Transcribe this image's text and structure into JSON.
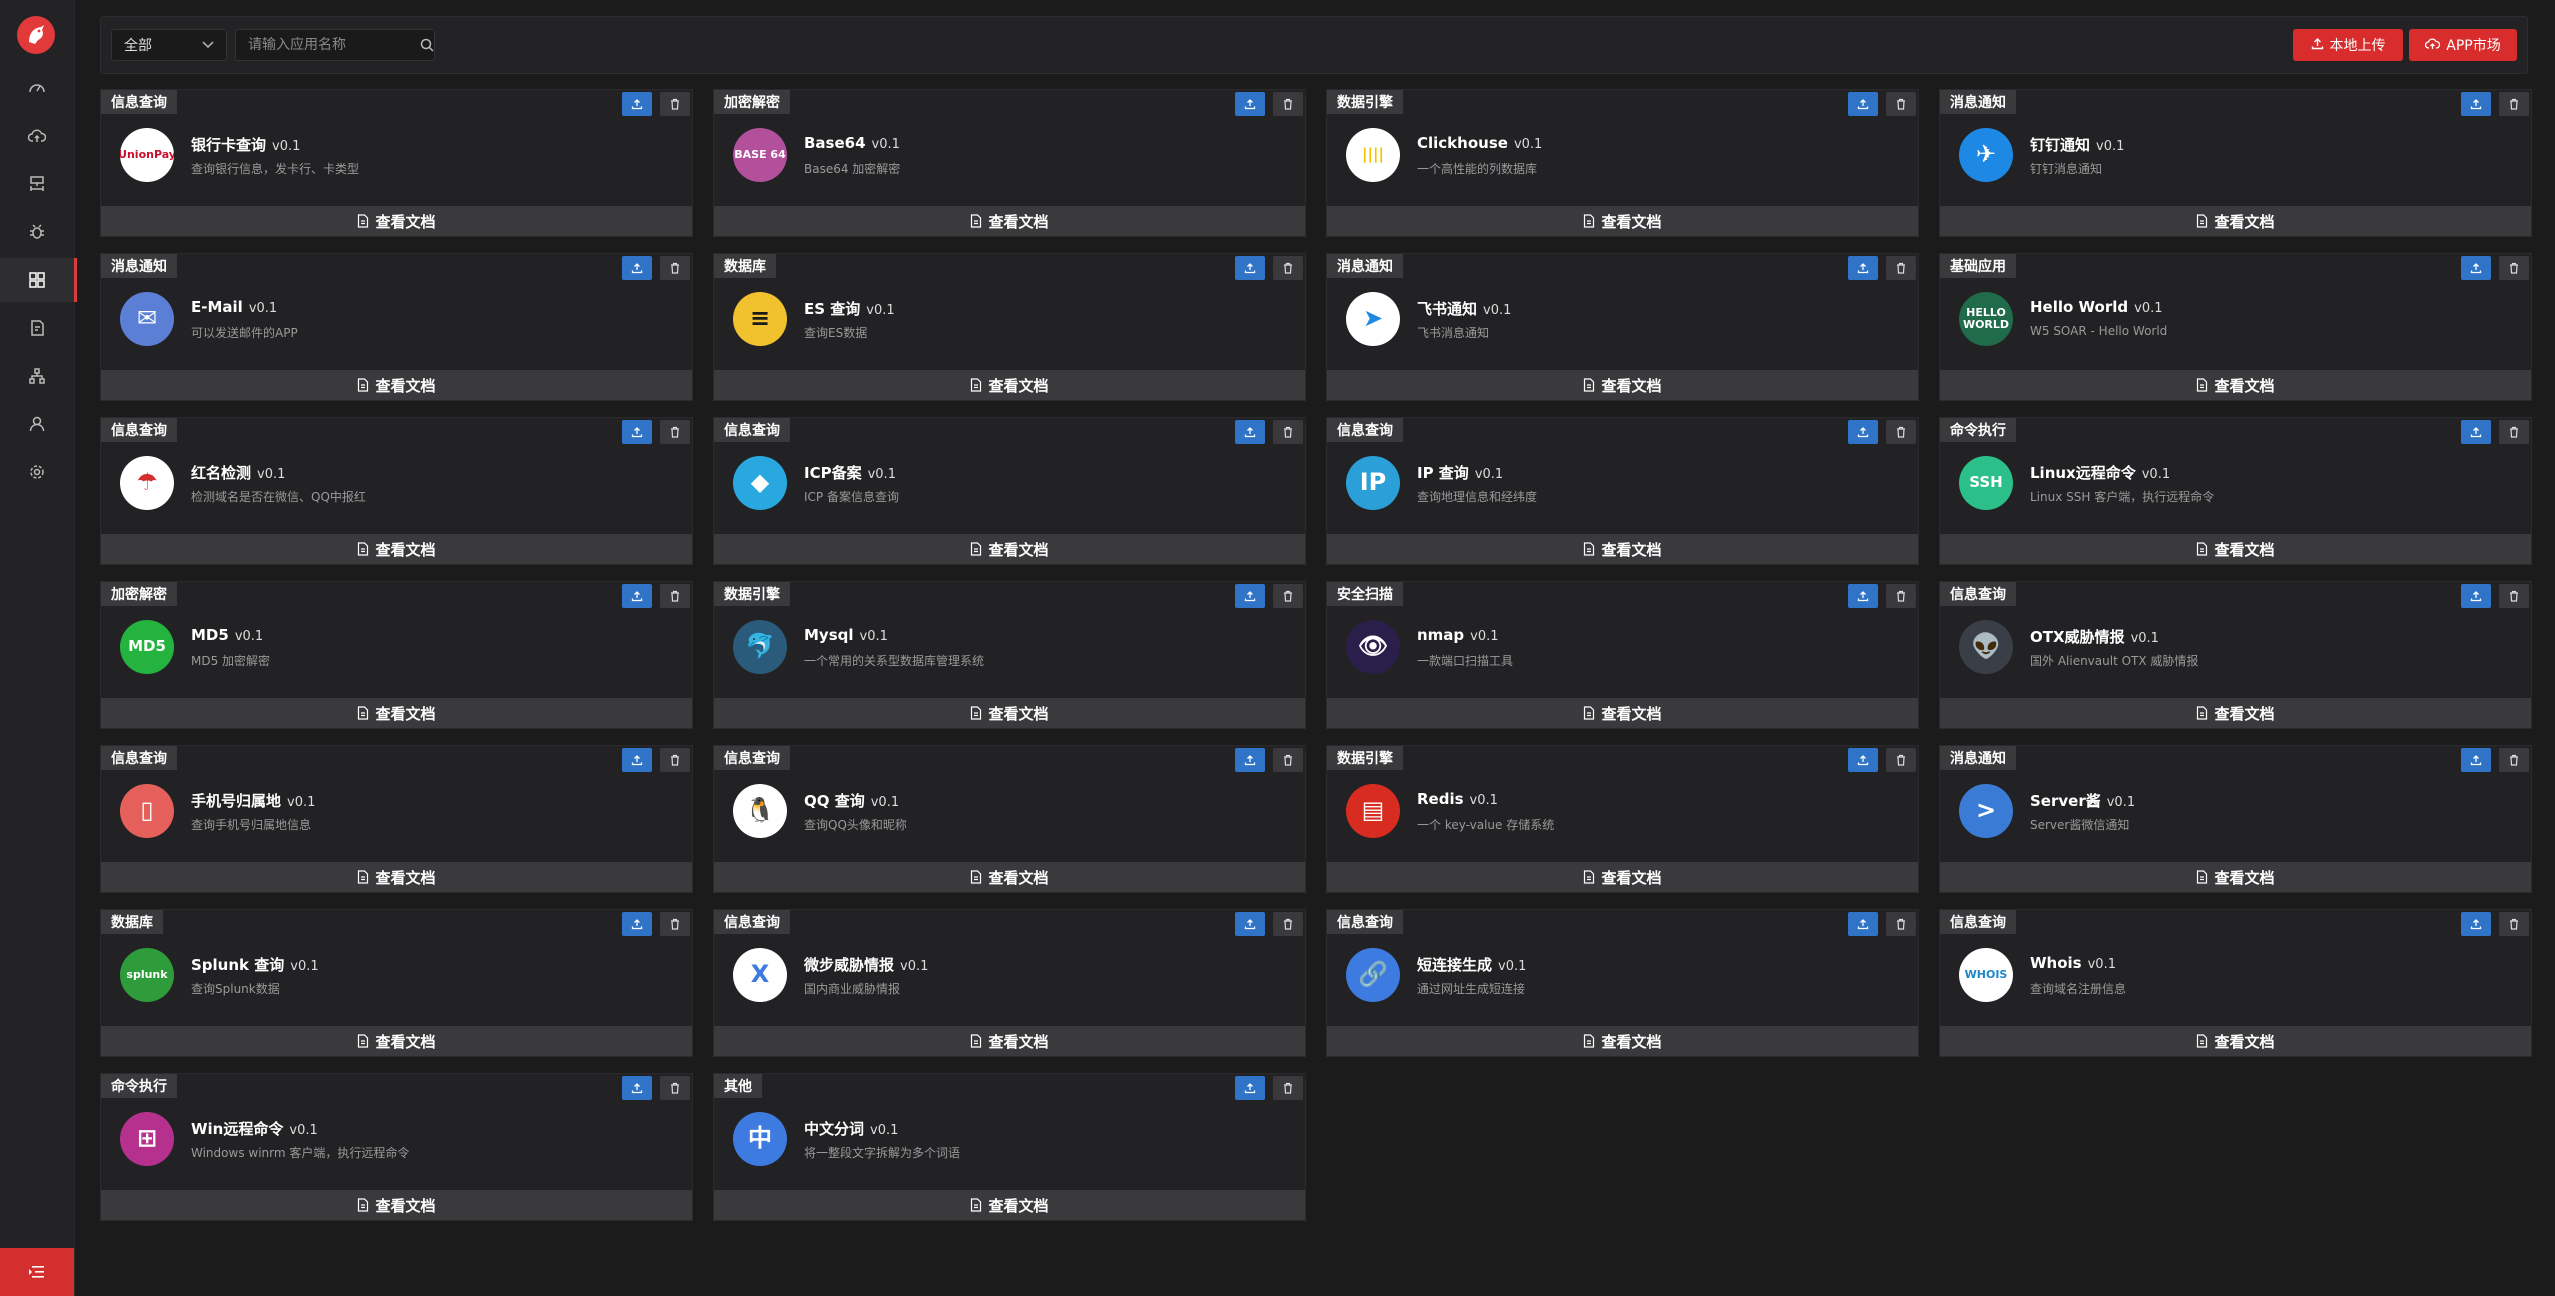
{
  "sidebar": {
    "items": [
      {
        "icon": "dashboard-icon",
        "active": false
      },
      {
        "icon": "cloud-icon",
        "active": false
      },
      {
        "icon": "server-icon",
        "active": false
      },
      {
        "icon": "bug-icon",
        "active": false
      },
      {
        "icon": "apps-grid-icon",
        "active": true
      },
      {
        "icon": "document-icon",
        "active": false
      },
      {
        "icon": "sitemap-icon",
        "active": false
      },
      {
        "icon": "user-icon",
        "active": false
      },
      {
        "icon": "settings-icon",
        "active": false
      }
    ]
  },
  "toolbar": {
    "filter_value": "全部",
    "search_placeholder": "请输入应用名称",
    "upload_label": "本地上传",
    "market_label": "APP市场"
  },
  "doc_label": "查看文档",
  "apps": [
    {
      "category": "信息查询",
      "name": "银行卡查询",
      "version": "v0.1",
      "desc": "查询银行信息，发卡行、卡类型",
      "icon": "unionpay-icon",
      "icon_text": "UnionPay",
      "icon_bg": "#ffffff",
      "icon_fg": "#c8102e"
    },
    {
      "category": "加密解密",
      "name": "Base64",
      "version": "v0.1",
      "desc": "Base64 加密解密",
      "icon": "base64-icon",
      "icon_text": "BASE 64",
      "icon_bg": "#b3509b",
      "icon_fg": "#ffffff"
    },
    {
      "category": "数据引擎",
      "name": "Clickhouse",
      "version": "v0.1",
      "desc": "一个高性能的列数据库",
      "icon": "clickhouse-icon",
      "icon_text": "||||",
      "icon_bg": "#ffffff",
      "icon_fg": "#f5c400"
    },
    {
      "category": "消息通知",
      "name": "钉钉通知",
      "version": "v0.1",
      "desc": "钉钉消息通知",
      "icon": "dingtalk-icon",
      "icon_text": "✈",
      "icon_bg": "#1e88e5",
      "icon_fg": "#ffffff"
    },
    {
      "category": "消息通知",
      "name": "E-Mail",
      "version": "v0.1",
      "desc": "可以发送邮件的APP",
      "icon": "email-icon",
      "icon_text": "✉",
      "icon_bg": "#5c7fd6",
      "icon_fg": "#ffffff"
    },
    {
      "category": "数据库",
      "name": "ES 查询",
      "version": "v0.1",
      "desc": "查询ES数据",
      "icon": "elasticsearch-icon",
      "icon_text": "≡",
      "icon_bg": "#f2c12e",
      "icon_fg": "#1b1b1c"
    },
    {
      "category": "消息通知",
      "name": "飞书通知",
      "version": "v0.1",
      "desc": "飞书消息通知",
      "icon": "feishu-icon",
      "icon_text": "➤",
      "icon_bg": "#ffffff",
      "icon_fg": "#1e88e5"
    },
    {
      "category": "基础应用",
      "name": "Hello World",
      "version": "v0.1",
      "desc": "W5 SOAR - Hello World",
      "icon": "hello-world-icon",
      "icon_text": "HELLO WORLD",
      "icon_bg": "#1f6b4a",
      "icon_fg": "#ffffff"
    },
    {
      "category": "信息查询",
      "name": "红名检测",
      "version": "v0.1",
      "desc": "检测域名是否在微信、QQ中报红",
      "icon": "umbrella-icon",
      "icon_text": "☂",
      "icon_bg": "#ffffff",
      "icon_fg": "#d32f2f"
    },
    {
      "category": "信息查询",
      "name": "ICP备案",
      "version": "v0.1",
      "desc": "ICP 备案信息查询",
      "icon": "icp-icon",
      "icon_text": "◆",
      "icon_bg": "#29a8e0",
      "icon_fg": "#ffffff"
    },
    {
      "category": "信息查询",
      "name": "IP 查询",
      "version": "v0.1",
      "desc": "查询地理信息和经纬度",
      "icon": "ip-icon",
      "icon_text": "IP",
      "icon_bg": "#2a9fd8",
      "icon_fg": "#ffffff"
    },
    {
      "category": "命令执行",
      "name": "Linux远程命令",
      "version": "v0.1",
      "desc": "Linux SSH 客户端，执行远程命令",
      "icon": "ssh-icon",
      "icon_text": "SSH",
      "icon_bg": "#2bbf8a",
      "icon_fg": "#ffffff"
    },
    {
      "category": "加密解密",
      "name": "MD5",
      "version": "v0.1",
      "desc": "MD5 加密解密",
      "icon": "md5-icon",
      "icon_text": "MD5",
      "icon_bg": "#25b33f",
      "icon_fg": "#ffffff"
    },
    {
      "category": "数据引擎",
      "name": "Mysql",
      "version": "v0.1",
      "desc": "一个常用的关系型数据库管理系统",
      "icon": "mysql-icon",
      "icon_text": "🐬",
      "icon_bg": "#2b5b7a",
      "icon_fg": "#e48e00"
    },
    {
      "category": "安全扫描",
      "name": "nmap",
      "version": "v0.1",
      "desc": "一款端口扫描工具",
      "icon": "nmap-icon",
      "icon_text": "👁",
      "icon_bg": "#2a1f4a",
      "icon_fg": "#ffffff"
    },
    {
      "category": "信息查询",
      "name": "OTX威胁情报",
      "version": "v0.1",
      "desc": "国外 Alienvault OTX 威胁情报",
      "icon": "alien-icon",
      "icon_text": "👽",
      "icon_bg": "#3a3f47",
      "icon_fg": "#ffffff"
    },
    {
      "category": "信息查询",
      "name": "手机号归属地",
      "version": "v0.1",
      "desc": "查询手机号归属地信息",
      "icon": "phone-icon",
      "icon_text": "▯",
      "icon_bg": "#e5605a",
      "icon_fg": "#ffffff"
    },
    {
      "category": "信息查询",
      "name": "QQ 查询",
      "version": "v0.1",
      "desc": "查询QQ头像和昵称",
      "icon": "qq-icon",
      "icon_text": "🐧",
      "icon_bg": "#ffffff",
      "icon_fg": "#000000"
    },
    {
      "category": "数据引擎",
      "name": "Redis",
      "version": "v0.1",
      "desc": "一个 key-value 存储系统",
      "icon": "redis-icon",
      "icon_text": "▤",
      "icon_bg": "#d82c20",
      "icon_fg": "#ffffff"
    },
    {
      "category": "消息通知",
      "name": "Server酱",
      "version": "v0.1",
      "desc": "Server酱微信通知",
      "icon": "serverchan-icon",
      "icon_text": ">",
      "icon_bg": "#3a7bd5",
      "icon_fg": "#ffffff"
    },
    {
      "category": "数据库",
      "name": "Splunk 查询",
      "version": "v0.1",
      "desc": "查询Splunk数据",
      "icon": "splunk-icon",
      "icon_text": "splunk",
      "icon_bg": "#2e9c3a",
      "icon_fg": "#ffffff"
    },
    {
      "category": "信息查询",
      "name": "微步威胁情报",
      "version": "v0.1",
      "desc": "国内商业威胁情报",
      "icon": "threatbook-icon",
      "icon_text": "X",
      "icon_bg": "#ffffff",
      "icon_fg": "#3d7be0"
    },
    {
      "category": "信息查询",
      "name": "短连接生成",
      "version": "v0.1",
      "desc": "通过网址生成短连接",
      "icon": "link-icon",
      "icon_text": "🔗",
      "icon_bg": "#3d7be0",
      "icon_fg": "#ffffff"
    },
    {
      "category": "信息查询",
      "name": "Whois",
      "version": "v0.1",
      "desc": "查询域名注册信息",
      "icon": "whois-icon",
      "icon_text": "WHOIS",
      "icon_bg": "#ffffff",
      "icon_fg": "#1e88c7"
    },
    {
      "category": "命令执行",
      "name": "Win远程命令",
      "version": "v0.1",
      "desc": "Windows winrm 客户端，执行远程命令",
      "icon": "windows-icon",
      "icon_text": "⊞",
      "icon_bg": "#b5318d",
      "icon_fg": "#ffffff"
    },
    {
      "category": "其他",
      "name": "中文分词",
      "version": "v0.1",
      "desc": "将一整段文字拆解为多个词语",
      "icon": "chinese-segment-icon",
      "icon_text": "中",
      "icon_bg": "#3d7be0",
      "icon_fg": "#ffffff"
    }
  ]
}
